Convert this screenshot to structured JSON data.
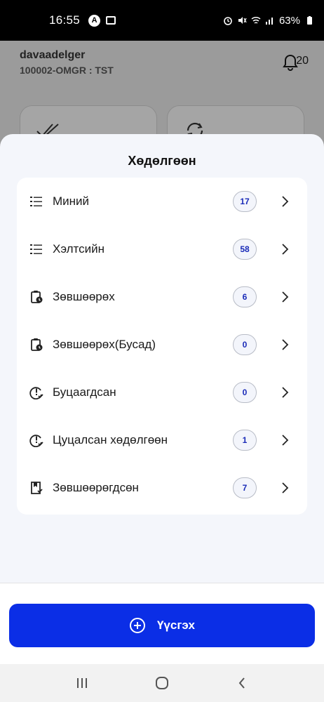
{
  "status_bar": {
    "time": "16:55",
    "battery": "63%"
  },
  "header": {
    "username": "davaadelger",
    "org": "100002-OMGR : TST",
    "notif_count": "20"
  },
  "sheet": {
    "title": "Хөдөлгөөн",
    "items": [
      {
        "label": "Миний",
        "count": "17",
        "icon": "list-icon"
      },
      {
        "label": "Хэлтсийн",
        "count": "58",
        "icon": "list-icon"
      },
      {
        "label": "Зөвшөөрөх",
        "count": "6",
        "icon": "clipboard-clock-icon"
      },
      {
        "label": "Зөвшөөрөх(Бусад)",
        "count": "0",
        "icon": "clipboard-clock-icon"
      },
      {
        "label": "Буцаагдсан",
        "count": "0",
        "icon": "alert-check-icon"
      },
      {
        "label": "Цуцалсан хөдөлгөөн",
        "count": "1",
        "icon": "alert-check-icon"
      },
      {
        "label": "Зөвшөөрөгдсөн",
        "count": "7",
        "icon": "approved-doc-icon"
      }
    ]
  },
  "create_button": {
    "label": "Үүсгэх"
  },
  "colors": {
    "primary": "#0b2ee6",
    "badge_text": "#1a2bb8",
    "sheet_bg": "#f4f6fb"
  }
}
